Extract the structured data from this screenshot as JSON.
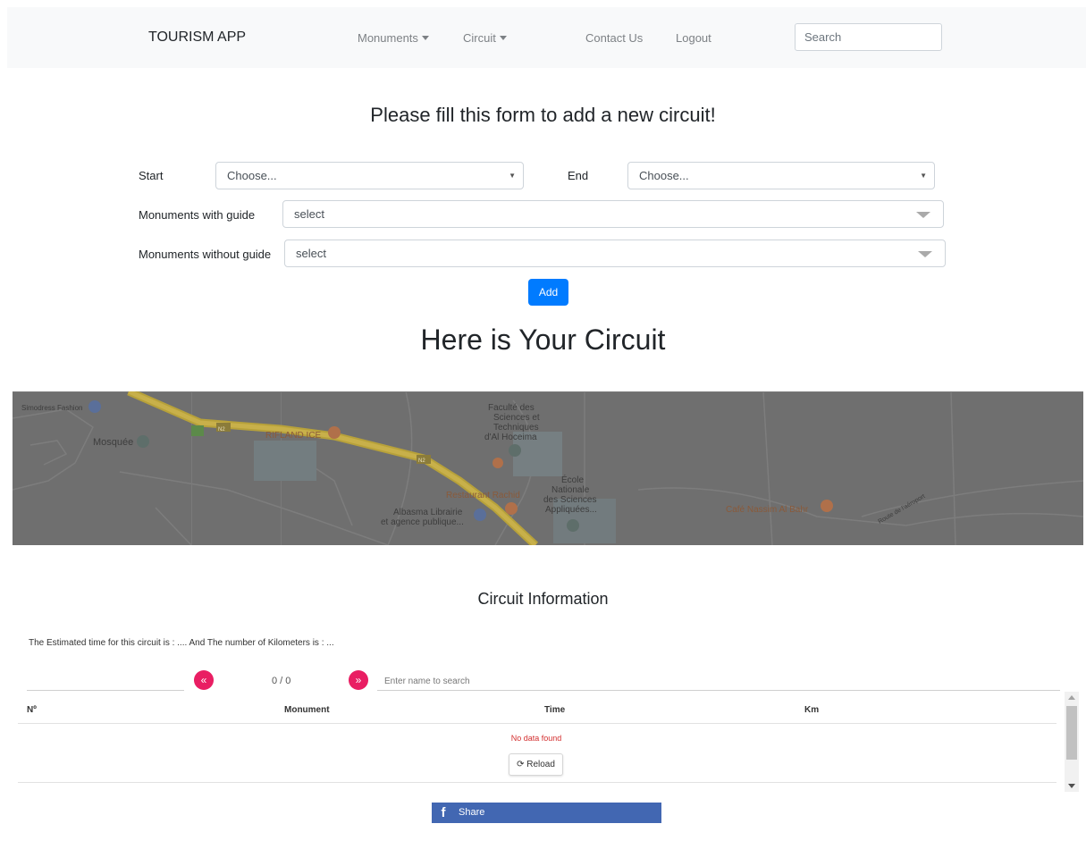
{
  "navbar": {
    "brand": "TOURISM APP",
    "items": [
      {
        "label": "Monuments",
        "dropdown": true
      },
      {
        "label": "Circuit",
        "dropdown": true
      },
      {
        "label": "Contact Us",
        "dropdown": false
      },
      {
        "label": "Logout",
        "dropdown": false
      }
    ],
    "search_placeholder": "Search"
  },
  "form": {
    "title": "Please fill this form to add a new circuit!",
    "start_label": "Start",
    "start_value": "Choose...",
    "end_label": "End",
    "end_value": "Choose...",
    "with_guide_label": "Monuments with guide",
    "with_guide_value": "select",
    "without_guide_label": "Monuments without guide",
    "without_guide_value": "select",
    "add_label": "Add"
  },
  "circuit": {
    "title": "Here is Your Circuit"
  },
  "map": {
    "labels": [
      "Simodress Fashion",
      "Mosquée",
      "RIFLAND ICE",
      "Faculté des",
      "Sciences et",
      "Techniques",
      "d'Al Hoceima",
      "École",
      "Nationale",
      "des Sciences",
      "Appliquées...",
      "Restaurant Rachid",
      "Albasma Librairie",
      "et agence publique...",
      "Café Nassim Al Bahr",
      "Route de l'aéroport"
    ],
    "road_shields": [
      "N2",
      "N2"
    ]
  },
  "info": {
    "title": "Circuit Information",
    "estimate_text": "The Estimated time for this circuit is : .... And The number of Kilometers is : ...",
    "page_count": "0 / 0",
    "prev_icon": "«",
    "next_icon": "»",
    "search_placeholder": "Enter name to search",
    "columns": [
      "Nº",
      "Monument",
      "Time",
      "Km"
    ],
    "no_data": "No data found",
    "reload_label": "Reload"
  },
  "share": {
    "label": "Share",
    "icon": "f"
  },
  "colors": {
    "primary": "#007bff",
    "accent_pink": "#e91e63",
    "facebook": "#4267b2",
    "error_red": "#d32f2f"
  }
}
